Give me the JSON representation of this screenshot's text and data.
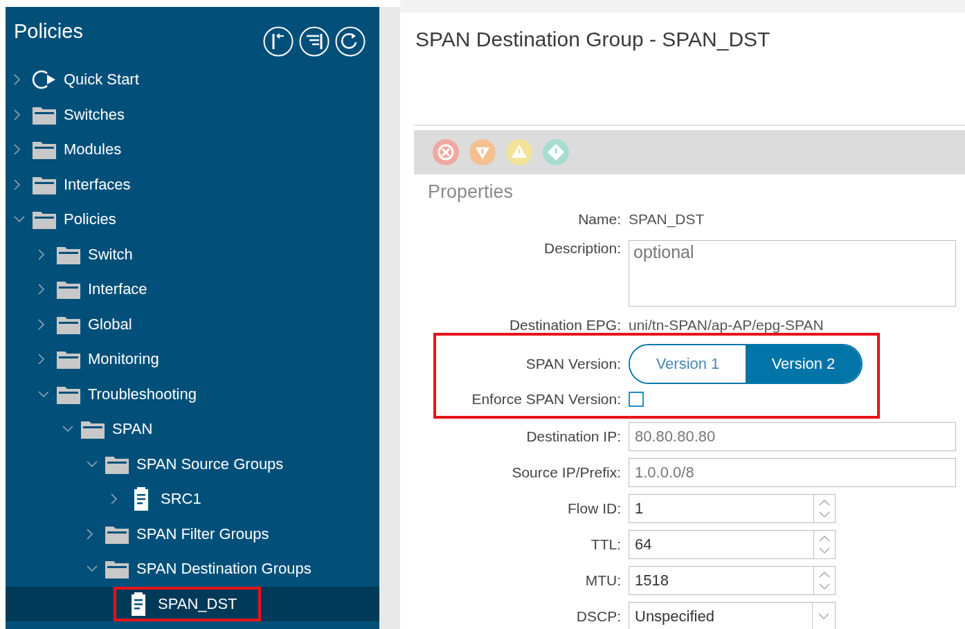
{
  "sidebar": {
    "title": "Policies",
    "tree": [
      {
        "label": "Quick Start",
        "kind": "start",
        "expanded": false,
        "selected": false
      },
      {
        "label": "Switches",
        "kind": "folder",
        "expanded": false,
        "selected": false
      },
      {
        "label": "Modules",
        "kind": "folder",
        "expanded": false,
        "selected": false
      },
      {
        "label": "Interfaces",
        "kind": "folder",
        "expanded": false,
        "selected": false
      },
      {
        "label": "Policies",
        "kind": "folder",
        "expanded": true,
        "selected": false,
        "children": [
          {
            "label": "Switch",
            "kind": "folder",
            "expanded": false,
            "selected": false
          },
          {
            "label": "Interface",
            "kind": "folder",
            "expanded": false,
            "selected": false
          },
          {
            "label": "Global",
            "kind": "folder",
            "expanded": false,
            "selected": false
          },
          {
            "label": "Monitoring",
            "kind": "folder",
            "expanded": false,
            "selected": false
          },
          {
            "label": "Troubleshooting",
            "kind": "folder",
            "expanded": true,
            "selected": false,
            "children": [
              {
                "label": "SPAN",
                "kind": "folder",
                "expanded": true,
                "selected": false,
                "children": [
                  {
                    "label": "SPAN Source Groups",
                    "kind": "folder",
                    "expanded": true,
                    "selected": false,
                    "children": [
                      {
                        "label": "SRC1",
                        "kind": "doc",
                        "expanded": false,
                        "selected": false
                      }
                    ]
                  },
                  {
                    "label": "SPAN Filter Groups",
                    "kind": "folder",
                    "expanded": false,
                    "selected": false
                  },
                  {
                    "label": "SPAN Destination Groups",
                    "kind": "folder",
                    "expanded": true,
                    "selected": false,
                    "children": [
                      {
                        "label": "SPAN_DST",
                        "kind": "doc",
                        "selected": true,
                        "highlighted": true
                      }
                    ]
                  }
                ]
              }
            ]
          }
        ]
      }
    ]
  },
  "panel": {
    "title": "SPAN Destination Group - SPAN_DST",
    "section": "Properties",
    "fields": [
      {
        "label": "Name:",
        "kind": "text",
        "value": "SPAN_DST",
        "highlighted": false
      },
      {
        "label": "Description:",
        "kind": "textarea",
        "placeholder": "optional",
        "highlighted": false
      },
      {
        "label": "Destination EPG:",
        "kind": "text",
        "value": "uni/tn-SPAN/ap-AP/epg-SPAN",
        "highlighted": false
      },
      {
        "label": "SPAN Version:",
        "kind": "toggle",
        "options": [
          {
            "label": "Version 1",
            "selected": false
          },
          {
            "label": "Version 2",
            "selected": true
          }
        ],
        "highlighted": true
      },
      {
        "label": "Enforce SPAN Version:",
        "kind": "checkbox",
        "checked": false,
        "highlighted": true
      },
      {
        "label": "Destination IP:",
        "kind": "input",
        "value": "80.80.80.80",
        "disabled": true,
        "highlighted": false
      },
      {
        "label": "Source IP/Prefix:",
        "kind": "input",
        "value": "1.0.0.0/8",
        "disabled": true,
        "highlighted": false
      },
      {
        "label": "Flow ID:",
        "kind": "spinner",
        "value": "1",
        "highlighted": false
      },
      {
        "label": "TTL:",
        "kind": "spinner",
        "value": "64",
        "highlighted": false
      },
      {
        "label": "MTU:",
        "kind": "spinner",
        "value": "1518",
        "highlighted": false
      },
      {
        "label": "DSCP:",
        "kind": "select",
        "value": "Unspecified",
        "highlighted": false
      }
    ]
  }
}
